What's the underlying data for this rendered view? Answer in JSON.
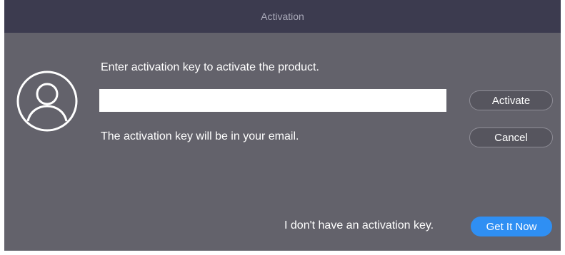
{
  "window": {
    "title": "Activation"
  },
  "main": {
    "prompt": "Enter activation key to activate the product.",
    "key_input": {
      "value": "",
      "placeholder": ""
    },
    "hint": "The activation key will be in your email.",
    "no_key_text": "I don't have an activation key."
  },
  "buttons": {
    "activate": "Activate",
    "cancel": "Cancel",
    "get_it_now": "Get It Now"
  },
  "icons": {
    "avatar": "user-avatar-icon"
  },
  "colors": {
    "titlebar": "#3c3b4f",
    "background": "#63626b",
    "accent": "#2f8ff3"
  }
}
